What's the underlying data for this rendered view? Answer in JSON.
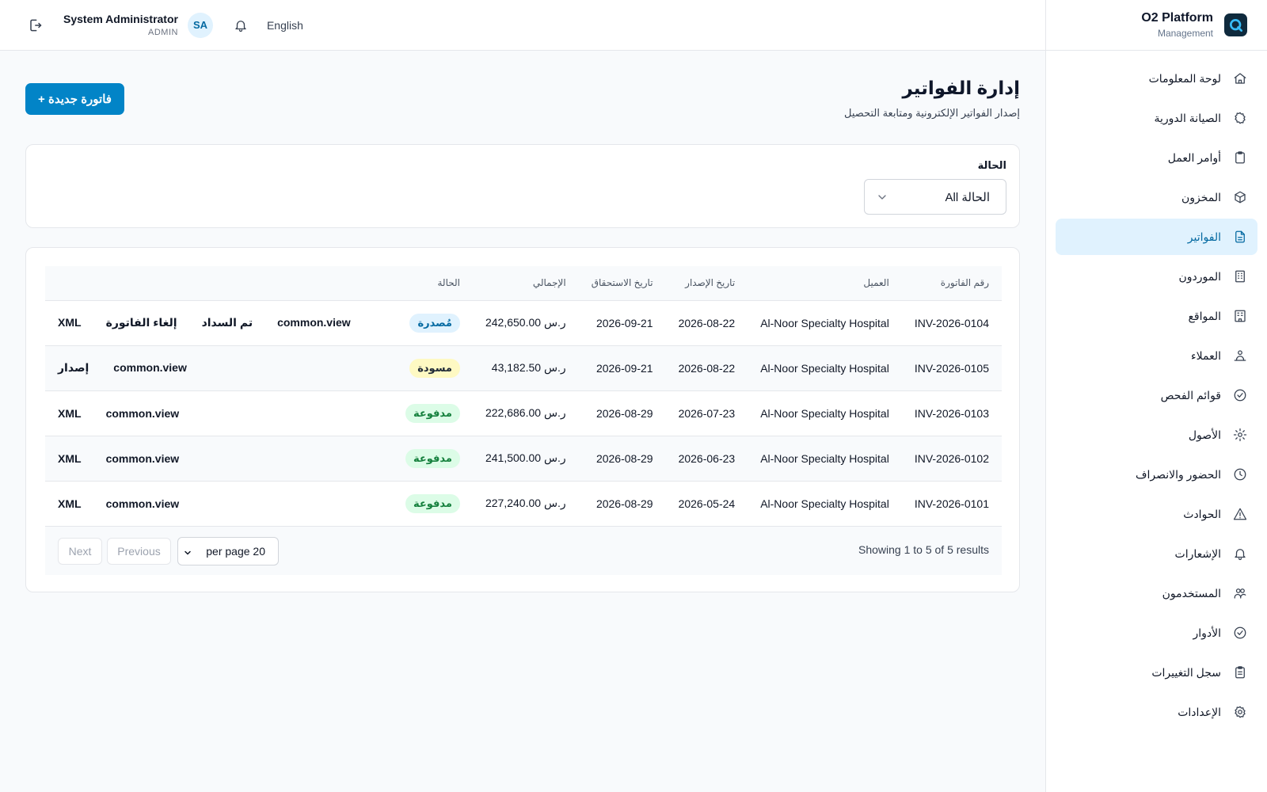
{
  "brand": {
    "title": "O2 Platform",
    "subtitle": "Management",
    "icon": "brand-logo-icon"
  },
  "topbar": {
    "user_name": "System Administrator",
    "user_role": "ADMIN",
    "avatar_initials": "SA",
    "language": "English"
  },
  "sidebar": {
    "items": [
      {
        "label": "لوحة المعلومات",
        "icon": "home-icon",
        "active": false
      },
      {
        "label": "الصيانة الدورية",
        "icon": "gear-outline-icon",
        "active": false
      },
      {
        "label": "أوامر العمل",
        "icon": "clipboard-icon",
        "active": false
      },
      {
        "label": "المخزون",
        "icon": "box-icon",
        "active": false
      },
      {
        "label": "الفواتير",
        "icon": "file-text-icon",
        "active": true
      },
      {
        "label": "الموردون",
        "icon": "building-icon",
        "active": false
      },
      {
        "label": "المواقع",
        "icon": "location-building-icon",
        "active": false
      },
      {
        "label": "العملاء",
        "icon": "users-group-icon",
        "active": false
      },
      {
        "label": "قوائم الفحص",
        "icon": "check-circle-icon",
        "active": false
      },
      {
        "label": "الأصول",
        "icon": "cog-icon",
        "active": false
      },
      {
        "label": "الحضور والانصراف",
        "icon": "clock-icon",
        "active": false
      },
      {
        "label": "الحوادث",
        "icon": "warning-icon",
        "active": false
      },
      {
        "label": "الإشعارات",
        "icon": "bell-icon",
        "active": false
      },
      {
        "label": "المستخدمون",
        "icon": "users-icon",
        "active": false
      },
      {
        "label": "الأدوار",
        "icon": "badge-check-icon",
        "active": false
      },
      {
        "label": "سجل التغييرات",
        "icon": "clipboard-list-icon",
        "active": false
      },
      {
        "label": "الإعدادات",
        "icon": "settings-icon",
        "active": false
      }
    ]
  },
  "page": {
    "title": "إدارة الفواتير",
    "subtitle": "إصدار الفواتير الإلكترونية ومتابعة التحصيل",
    "new_button": "+ فاتورة جديدة"
  },
  "filter": {
    "label": "الحالة",
    "value": "All الحالة"
  },
  "table": {
    "headers": [
      "رقم الفاتورة",
      "العميل",
      "تاريخ الإصدار",
      "تاريخ الاستحقاق",
      "الإجمالي",
      "الحالة"
    ],
    "rows": [
      {
        "number": "INV-2026-0104",
        "client": "Al-Noor Specialty Hospital",
        "issue_date": "2026-08-22",
        "due_date": "2026-09-21",
        "total": "242,650.00 ر.س",
        "status": "مُصدرة",
        "status_kind": "issued",
        "actions": [
          "common.view",
          "تم السداد",
          "إلغاء الفاتورة",
          "XML"
        ]
      },
      {
        "number": "INV-2026-0105",
        "client": "Al-Noor Specialty Hospital",
        "issue_date": "2026-08-22",
        "due_date": "2026-09-21",
        "total": "43,182.50 ر.س",
        "status": "مسودة",
        "status_kind": "draft",
        "actions": [
          "common.view",
          "إصدار"
        ]
      },
      {
        "number": "INV-2026-0103",
        "client": "Al-Noor Specialty Hospital",
        "issue_date": "2026-07-23",
        "due_date": "2026-08-29",
        "total": "222,686.00 ر.س",
        "status": "مدفوعة",
        "status_kind": "paid",
        "actions": [
          "common.view",
          "XML"
        ]
      },
      {
        "number": "INV-2026-0102",
        "client": "Al-Noor Specialty Hospital",
        "issue_date": "2026-06-23",
        "due_date": "2026-08-29",
        "total": "241,500.00 ر.س",
        "status": "مدفوعة",
        "status_kind": "paid",
        "actions": [
          "common.view",
          "XML"
        ]
      },
      {
        "number": "INV-2026-0101",
        "client": "Al-Noor Specialty Hospital",
        "issue_date": "2026-05-24",
        "due_date": "2026-08-29",
        "total": "227,240.00 ر.س",
        "status": "مدفوعة",
        "status_kind": "paid",
        "actions": [
          "common.view",
          "XML"
        ]
      }
    ]
  },
  "pagination": {
    "info": "Showing 1 to 5 of 5 results",
    "per_page": "per page 20",
    "previous": "Previous",
    "next": "Next"
  },
  "colors": {
    "accent": "#0284c7",
    "active_bg": "#e0f2fe",
    "active_text": "#0369a1",
    "paid_bg": "#dcfce7",
    "draft_bg": "#fef9c3"
  }
}
